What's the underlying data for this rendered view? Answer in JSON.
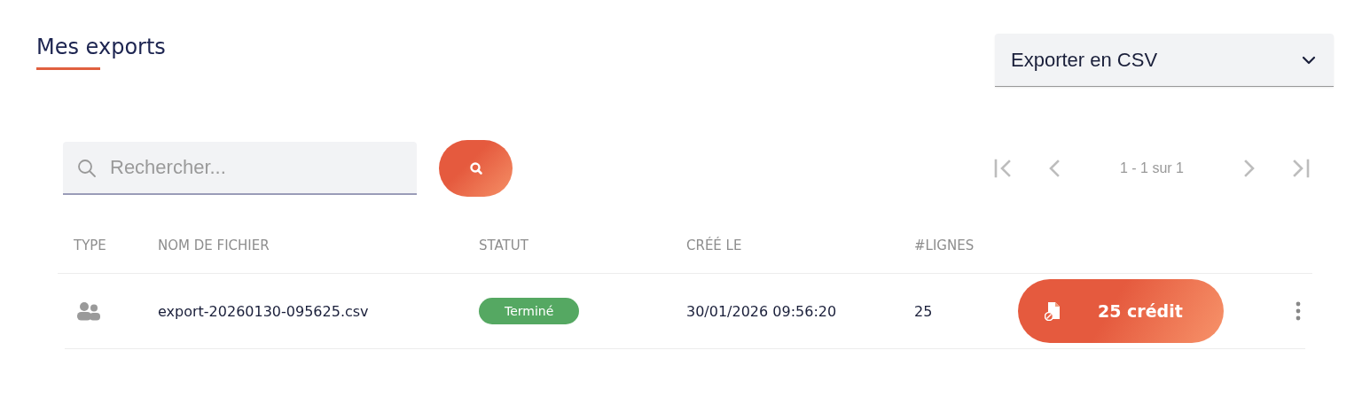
{
  "page": {
    "title": "Mes exports"
  },
  "export_dropdown": {
    "value": "Exporter en CSV"
  },
  "search": {
    "placeholder": "Rechercher..."
  },
  "pagination": {
    "range": "1 - 1 sur 1",
    "first_disabled": true,
    "prev_disabled": true,
    "next_disabled": true,
    "last_disabled": true
  },
  "table": {
    "columns": [
      "TYPE",
      "NOM DE FICHIER",
      "STATUT",
      "CRÉÉ LE",
      "#LIGNES"
    ],
    "rows": [
      {
        "kind": "contacts",
        "file_name": "export-20260130-095625.csv",
        "status": {
          "label": "Terminé",
          "kind": "done"
        },
        "created": "30/01/2026 09:56:20",
        "lines": "25",
        "credit": "25 crédit"
      }
    ]
  }
}
